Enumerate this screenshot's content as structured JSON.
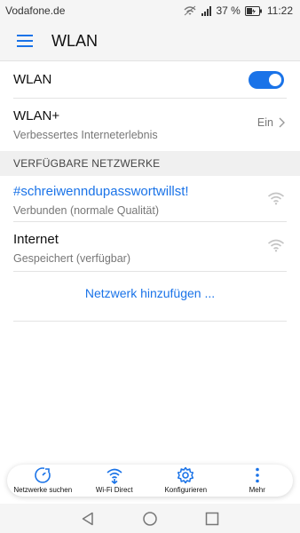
{
  "status_bar": {
    "carrier": "Vodafone.de",
    "battery_percent": "37 %",
    "time": "11:22",
    "icons": [
      "wifi-calling-icon",
      "signal-icon",
      "battery-icon"
    ]
  },
  "app_bar": {
    "title": "WLAN",
    "menu_icon": "hamburger-menu-icon"
  },
  "settings": {
    "wlan_toggle_label": "WLAN",
    "wlan_enabled": true,
    "wlan_plus_label": "WLAN+",
    "wlan_plus_desc": "Verbessertes Interneterlebnis",
    "wlan_plus_value": "Ein"
  },
  "section_header": "VERFÜGBARE NETZWERKE",
  "networks": [
    {
      "name": "#schreiwenndupasswortwillst!",
      "status": "Verbunden (normale Qualität)",
      "connected": true,
      "icon": "wifi-signal-icon"
    },
    {
      "name": "Internet",
      "status": "Gespeichert (verfügbar)",
      "connected": false,
      "icon": "wifi-signal-icon"
    }
  ],
  "add_network": "Netzwerk hinzufügen ...",
  "bottom_tabs": [
    {
      "label": "Netzwerke suchen",
      "icon": "scan-icon"
    },
    {
      "label": "Wi-Fi Direct",
      "icon": "wifi-direct-icon"
    },
    {
      "label": "Konfigurieren",
      "icon": "gear-icon"
    },
    {
      "label": "Mehr",
      "icon": "more-vertical-icon"
    }
  ],
  "nav_buttons": [
    "back-icon",
    "home-icon",
    "recents-icon"
  ],
  "colors": {
    "accent": "#1a73e8",
    "connected_text": "#1a73e8"
  }
}
